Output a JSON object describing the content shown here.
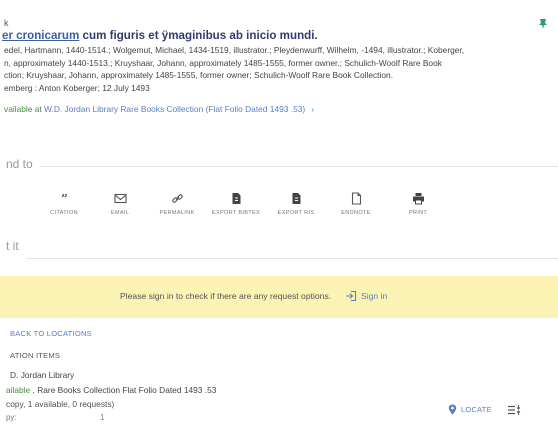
{
  "header": {
    "partial_label": "k"
  },
  "record": {
    "title_link": "er cronicarum",
    "title_rest": " cum figuris et ÿmaginibus ab inicio mundi.",
    "authors_lines": [
      "edel, Hartmann, 1440-1514.; Wolgemut, Michael, 1434-1519, illustrator.; Pleydenwurff, Wilhelm, -1494, illustrator.; Koberger,",
      "n, approximately 1440-1513.; Kruyshaar, Johann, approximately 1485-1555, former owner.; Schulich-Woolf Rare Book",
      "ction; Kruyshaar, Johann, approximately 1485-1555, former owner; Schulich-Woolf Rare Book Collection.",
      "emberg : Anton Koberger; 12 July 1493"
    ],
    "availability_prefix": "vailable at ",
    "availability_location": "W.D. Jordan Library  Rare Books Collection (Flat Folio Dated 1493 .53)",
    "availability_chevron": "›"
  },
  "send_to": {
    "label": "nd to",
    "actions": [
      {
        "label": "CITATION",
        "icon": "quote-icon"
      },
      {
        "label": "EMAIL",
        "icon": "envelope-icon"
      },
      {
        "label": "PERMALINK",
        "icon": "link-icon"
      },
      {
        "label": "EXPORT BIBTEX",
        "icon": "file-export-icon"
      },
      {
        "label": "EXPORT RIS",
        "icon": "file-export-icon"
      },
      {
        "label": "ENDNOTE",
        "icon": "document-icon"
      },
      {
        "label": "PRINT",
        "icon": "printer-icon"
      }
    ]
  },
  "get_it": {
    "label": "t it",
    "signin_message": "Please sign in to check if there are any request options.",
    "signin_button": "Sign in",
    "back_link": "BACK TO LOCATIONS",
    "items_label": "ATION ITEMS",
    "library_name": "D. Jordan Library",
    "status_available": "ailable",
    "status_location": " , Rare Books Collection Flat Folio Dated 1493 .53",
    "copies_summary": "copy, 1 available, 0 requests)",
    "copy_label": "py:",
    "copy_value": "1",
    "locate_button": "LOCATE"
  },
  "colors": {
    "title": "#2f3d6e",
    "link": "#5a7fc1",
    "available": "#4c8a3f",
    "signin_bar": "#fbf3b4",
    "pin": "#2e9e6b"
  }
}
